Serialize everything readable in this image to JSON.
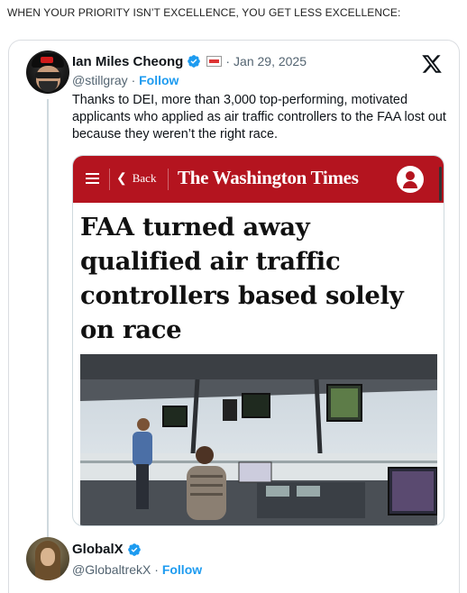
{
  "caption": "WHEN YOUR PRIORITY ISN’T EXCELLENCE, YOU GET LESS EXCELLENCE:",
  "post": {
    "author_name": "Ian Miles Cheong",
    "handle": "@stillgray",
    "follow_label": "Follow",
    "separator": "·",
    "date": "Jan 29, 2025",
    "text": "Thanks to DEI, more than 3,000 top-performing, motivated applicants who applied as air traffic controllers to the FAA lost out because they weren’t the right race.",
    "media": {
      "back_label": "Back",
      "publication": "The Washington Times",
      "headline": "FAA turned away qualified air traffic controllers based solely on race"
    }
  },
  "reply": {
    "author_name": "GlobalX",
    "handle": "@GlobaltrekX",
    "follow_label": "Follow"
  },
  "icons": {
    "verified": "verified-check-icon",
    "platform": "x-logo-icon",
    "menu": "hamburger-menu-icon",
    "user": "user-account-icon"
  },
  "colors": {
    "accent": "#1d9bf0",
    "brand_red": "#b4141f",
    "muted": "#536471"
  }
}
